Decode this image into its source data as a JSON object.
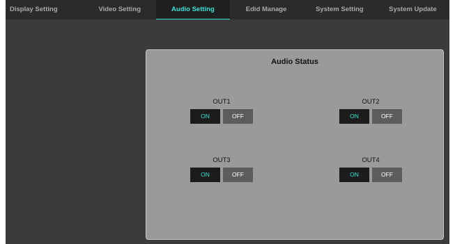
{
  "tabs": [
    {
      "label": "Display Setting",
      "active": false
    },
    {
      "label": "Video Setting",
      "active": false
    },
    {
      "label": "Audio Setting",
      "active": true
    },
    {
      "label": "Edid Manage",
      "active": false
    },
    {
      "label": "System Setting",
      "active": false
    },
    {
      "label": "System Update",
      "active": false
    }
  ],
  "panel": {
    "title": "Audio Status",
    "outputs": [
      {
        "label": "OUT1",
        "on_label": "ON",
        "off_label": "OFF",
        "state": "ON"
      },
      {
        "label": "OUT2",
        "on_label": "ON",
        "off_label": "OFF",
        "state": "ON"
      },
      {
        "label": "OUT3",
        "on_label": "ON",
        "off_label": "OFF",
        "state": "ON"
      },
      {
        "label": "OUT4",
        "on_label": "ON",
        "off_label": "OFF",
        "state": "ON"
      }
    ]
  },
  "colors": {
    "accent": "#35e3d8",
    "panel_bg": "#9a9a9a",
    "app_bg": "#3b3b3b",
    "tabbar_bg": "#2b2b2b"
  }
}
